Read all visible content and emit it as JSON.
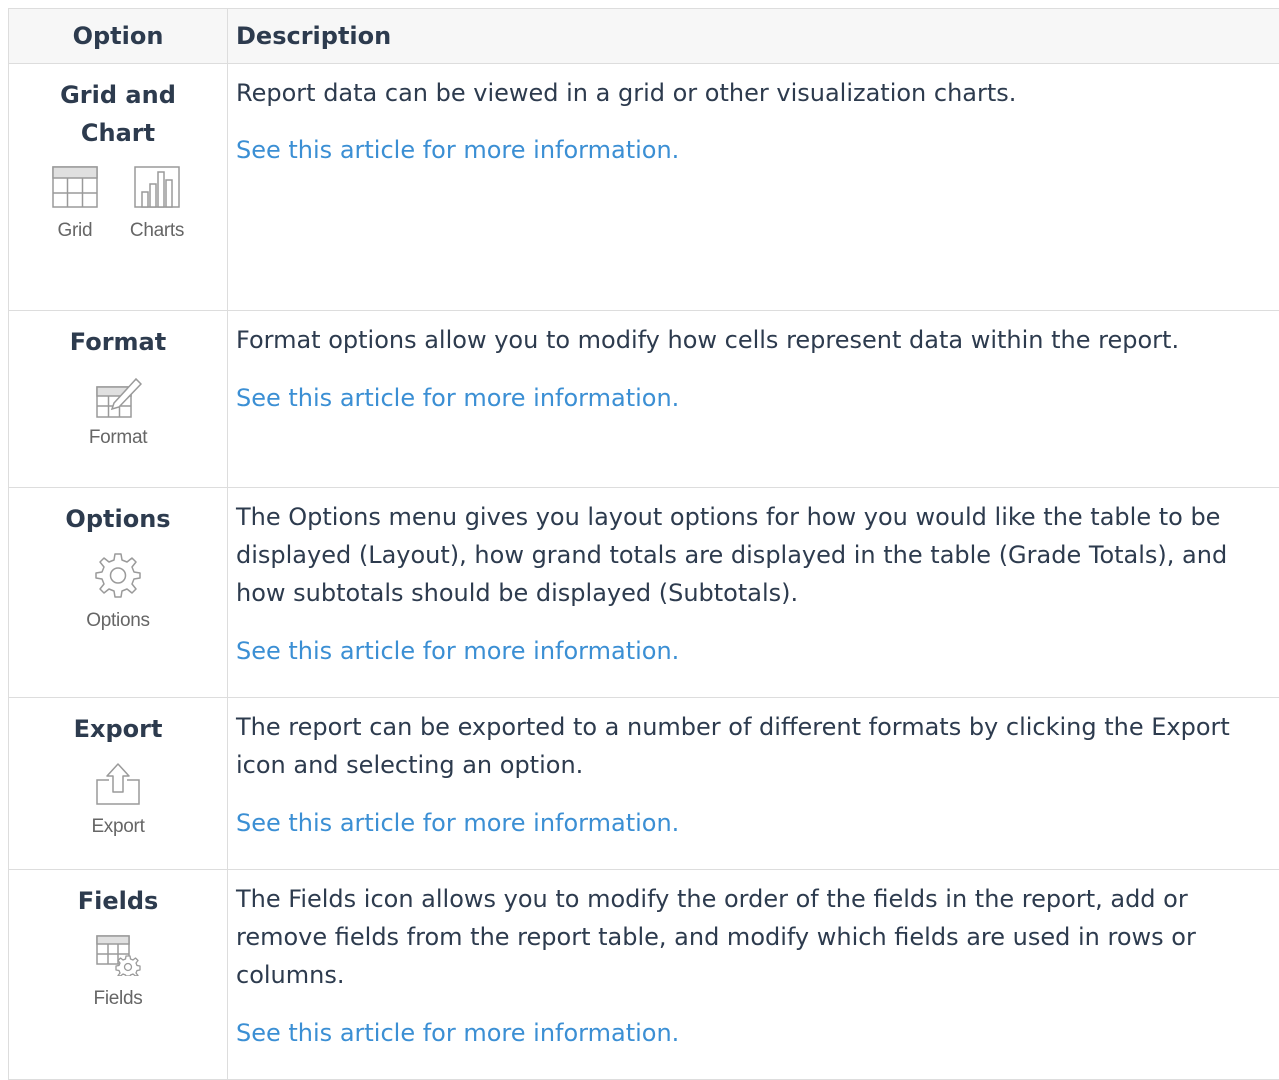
{
  "table": {
    "header": {
      "option": "Option",
      "description": "Description"
    },
    "link_text": "See this article for more information.",
    "link_color": "#3b8fd4",
    "rows": [
      {
        "option": "Grid and Chart",
        "icons": [
          {
            "name": "grid-icon",
            "label": "Grid"
          },
          {
            "name": "bar-chart-icon",
            "label": "Charts"
          }
        ],
        "description": "Report data can be viewed in a grid or other visualization charts.",
        "link": "See this article for more information."
      },
      {
        "option": "Format",
        "icons": [
          {
            "name": "format-icon",
            "label": "Format"
          }
        ],
        "description": "Format options allow you to modify how cells represent data within the report.",
        "link": "See this article for more information."
      },
      {
        "option": "Options",
        "icons": [
          {
            "name": "gear-icon",
            "label": "Options"
          }
        ],
        "description": "The Options menu gives you layout options for how you would like the table to be displayed (Layout), how grand totals are displayed in the table (Grade Totals), and how subtotals should be displayed (Subtotals).",
        "link": "See this article for more information."
      },
      {
        "option": "Export",
        "icons": [
          {
            "name": "export-icon",
            "label": "Export"
          }
        ],
        "description": "The report can be exported to a number of different formats by clicking the Export icon and selecting an option.",
        "link": "See this article for more information."
      },
      {
        "option": "Fields",
        "icons": [
          {
            "name": "fields-icon",
            "label": "Fields"
          }
        ],
        "description": "The Fields icon allows you to modify the order of the fields in the report, add or remove fields from the report table, and modify which fields are used in rows or columns.",
        "link": "See this article for more information."
      }
    ]
  }
}
